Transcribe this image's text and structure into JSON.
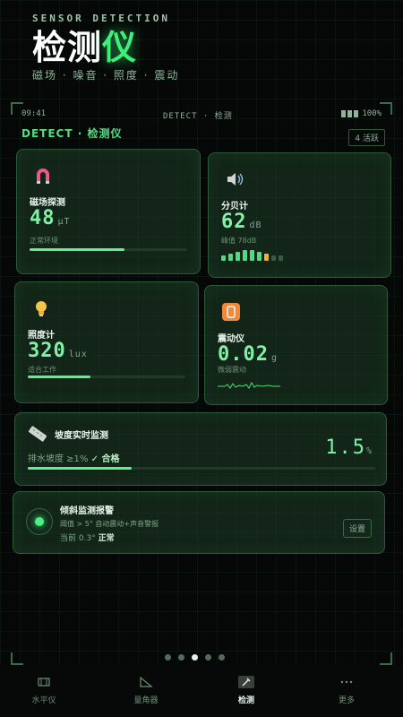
{
  "header": {
    "subtitle": "SENSOR DETECTION",
    "title_main": "检测",
    "title_accent": "仪",
    "tags": "磁场 · 噪音 · 照度 · 震动"
  },
  "statusbar": {
    "time": "09:41",
    "center": "DETECT · 检测",
    "battery": "100%"
  },
  "section": {
    "title": "DETECT · 检测仪",
    "badge": "4 活跃"
  },
  "cards": {
    "magnet": {
      "label": "磁场探测",
      "value": "48",
      "unit": "μT",
      "status": "正常环境",
      "level": 0.6
    },
    "sound": {
      "label": "分贝计",
      "value": "62",
      "unit": "dB",
      "status": "峰值 78dB"
    },
    "light": {
      "label": "照度计",
      "value": "320",
      "unit": "lux",
      "status": "适合工作",
      "level": 0.4
    },
    "vibration": {
      "label": "震动仪",
      "value": "0.02",
      "unit": "g",
      "status": "微弱震动"
    }
  },
  "slope": {
    "title": "坡度实时监测",
    "sub_text": "排水坡度 ≥1%",
    "sub_ok": "✓ 合格",
    "value": "1.5",
    "unit": "%",
    "level": 0.3
  },
  "alert": {
    "title": "倾斜监测报警",
    "desc": "阈值 > 5° 自动震动+声音警报",
    "current_label": "当前 0.3°",
    "current_status": "正常",
    "button": "设置"
  },
  "pager": {
    "count": 5,
    "active_index": 2
  },
  "tabs": [
    {
      "label": "水平仪",
      "icon": "level-icon"
    },
    {
      "label": "量角器",
      "icon": "protractor-icon"
    },
    {
      "label": "检测",
      "icon": "detect-icon"
    },
    {
      "label": "更多",
      "icon": "more-icon"
    }
  ],
  "colors": {
    "accent": "#3df07a",
    "background": "#050806",
    "card": "#1e3e28"
  }
}
